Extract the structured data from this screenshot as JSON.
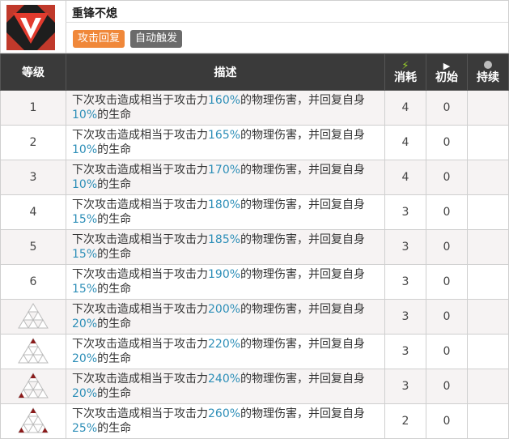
{
  "skill": {
    "name": "重锋不熄",
    "tags": [
      "攻击回复",
      "自动触发"
    ],
    "icon": "skill-icon"
  },
  "table": {
    "headers": {
      "level": "等级",
      "desc": "描述",
      "sp_cost": "消耗",
      "sp_init": "初始",
      "duration": "持续"
    },
    "header_icons": [
      "lightning-icon",
      "play-icon",
      "clock-icon"
    ],
    "rows": [
      {
        "level": "1",
        "pre": "下次攻击造成相当于攻击力",
        "atk": "160%",
        "mid": "的物理伤害，并回复自身",
        "heal": "10%",
        "post": "的生命",
        "cost": "4",
        "init": "0",
        "dur": ""
      },
      {
        "level": "2",
        "pre": "下次攻击造成相当于攻击力",
        "atk": "165%",
        "mid": "的物理伤害，并回复自身",
        "heal": "10%",
        "post": "的生命",
        "cost": "4",
        "init": "0",
        "dur": ""
      },
      {
        "level": "3",
        "pre": "下次攻击造成相当于攻击力",
        "atk": "170%",
        "mid": "的物理伤害，并回复自身",
        "heal": "10%",
        "post": "的生命",
        "cost": "4",
        "init": "0",
        "dur": ""
      },
      {
        "level": "4",
        "pre": "下次攻击造成相当于攻击力",
        "atk": "180%",
        "mid": "的物理伤害，并回复自身",
        "heal": "15%",
        "post": "的生命",
        "cost": "3",
        "init": "0",
        "dur": ""
      },
      {
        "level": "5",
        "pre": "下次攻击造成相当于攻击力",
        "atk": "185%",
        "mid": "的物理伤害，并回复自身",
        "heal": "15%",
        "post": "的生命",
        "cost": "3",
        "init": "0",
        "dur": ""
      },
      {
        "level": "6",
        "pre": "下次攻击造成相当于攻击力",
        "atk": "190%",
        "mid": "的物理伤害，并回复自身",
        "heal": "15%",
        "post": "的生命",
        "cost": "3",
        "init": "0",
        "dur": ""
      },
      {
        "level": "",
        "mastery": 0,
        "pre": "下次攻击造成相当于攻击力",
        "atk": "200%",
        "mid": "的物理伤害，并回复自身",
        "heal": "20%",
        "post": "的生命",
        "cost": "3",
        "init": "0",
        "dur": ""
      },
      {
        "level": "",
        "mastery": 1,
        "pre": "下次攻击造成相当于攻击力",
        "atk": "220%",
        "mid": "的物理伤害，并回复自身",
        "heal": "20%",
        "post": "的生命",
        "cost": "3",
        "init": "0",
        "dur": ""
      },
      {
        "level": "",
        "mastery": 2,
        "pre": "下次攻击造成相当于攻击力",
        "atk": "240%",
        "mid": "的物理伤害，并回复自身",
        "heal": "20%",
        "post": "的生命",
        "cost": "3",
        "init": "0",
        "dur": ""
      },
      {
        "level": "",
        "mastery": 3,
        "pre": "下次攻击造成相当于攻击力",
        "atk": "260%",
        "mid": "的物理伤害，并回复自身",
        "heal": "25%",
        "post": "的生命",
        "cost": "2",
        "init": "0",
        "dur": ""
      }
    ]
  },
  "colors": {
    "tag_orange": "#f0883a",
    "tag_gray": "#6b6b6b",
    "highlight": "#2e8fb8",
    "header_bg": "#3a3a3a",
    "mastery_red": "#8b1a1a"
  }
}
